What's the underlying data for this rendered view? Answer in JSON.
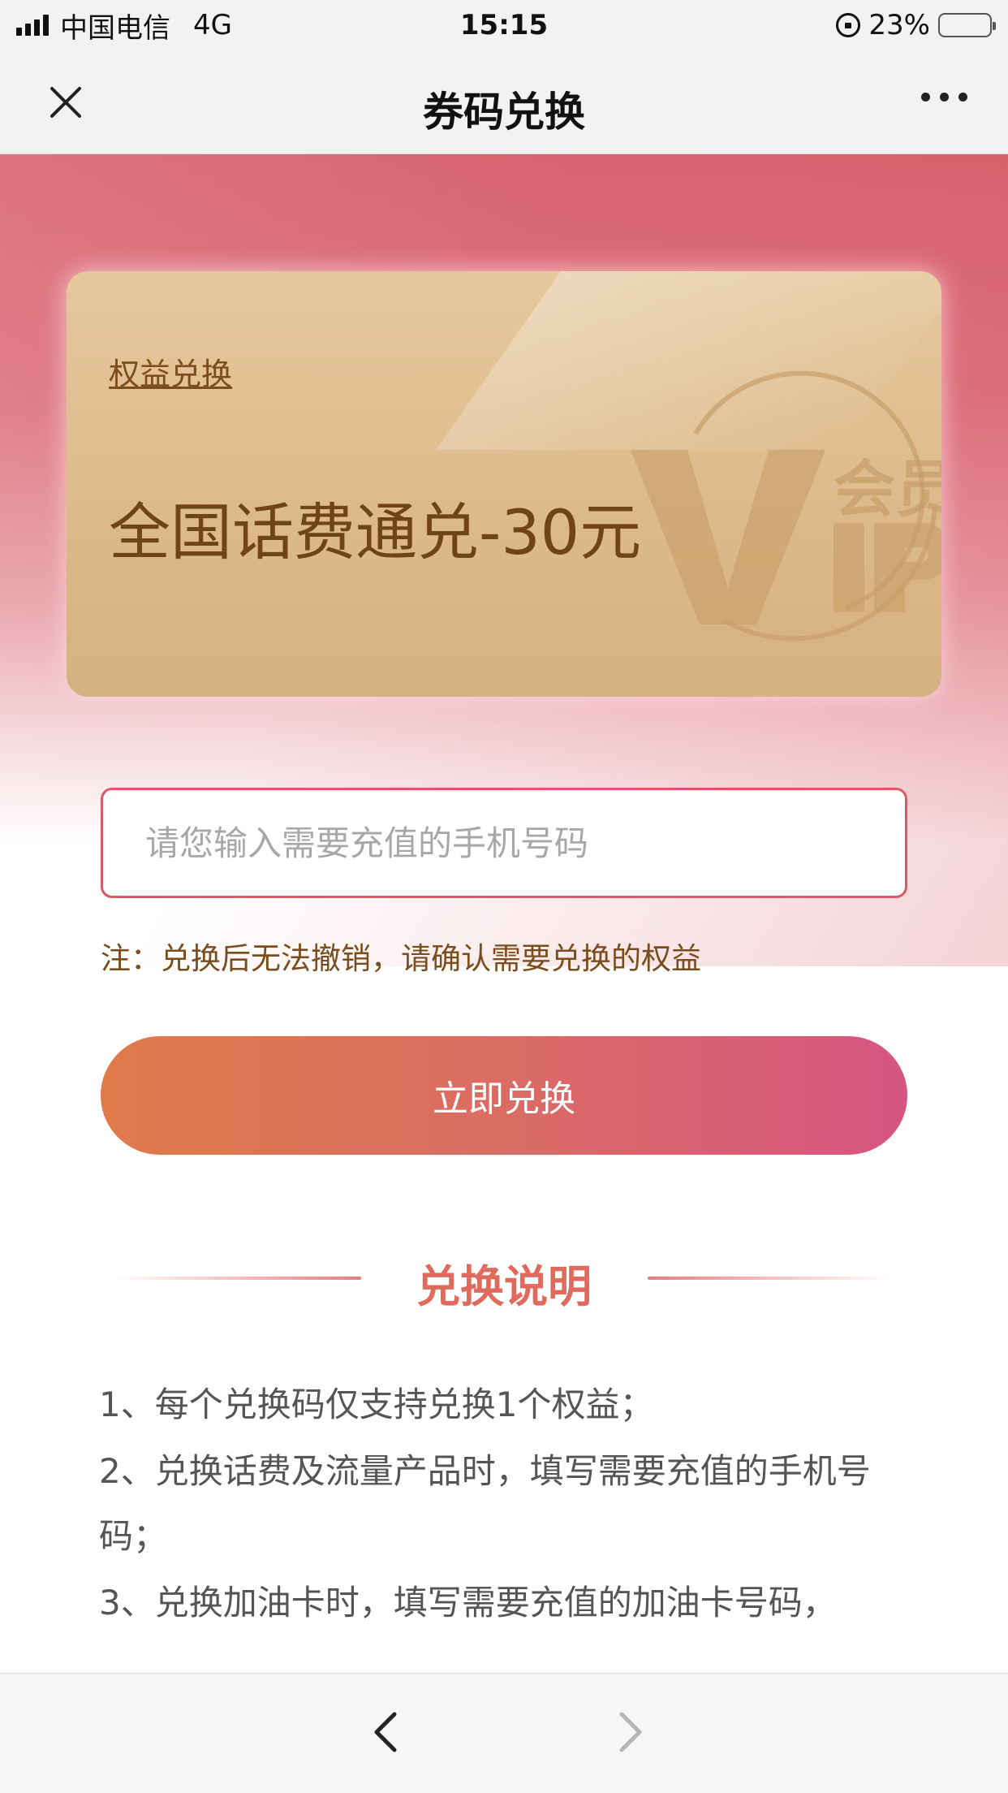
{
  "status_bar": {
    "carrier": "中国电信",
    "network": "4G",
    "time": "15:15",
    "battery": "23%"
  },
  "nav": {
    "title": "券码兑换"
  },
  "card": {
    "tag": "权益兑换",
    "title": "全国话费通兑-30元",
    "emblem_text": "会员"
  },
  "form": {
    "phone_placeholder": "请您输入需要充值的手机号码",
    "note": "注：兑换后无法撤销，请确认需要兑换的权益",
    "redeem_label": "立即兑换"
  },
  "instructions": {
    "title": "兑换说明",
    "items": [
      "1、每个兑换码仅支持兑换1个权益；",
      "2、兑换话费及流量产品时，填写需要充值的手机号码；",
      "3、兑换加油卡时，填写需要充值的加油卡号码，"
    ]
  },
  "colors": {
    "accent": "#d95a66",
    "brown": "#7a4d1c",
    "gold": "#dcb98a"
  }
}
